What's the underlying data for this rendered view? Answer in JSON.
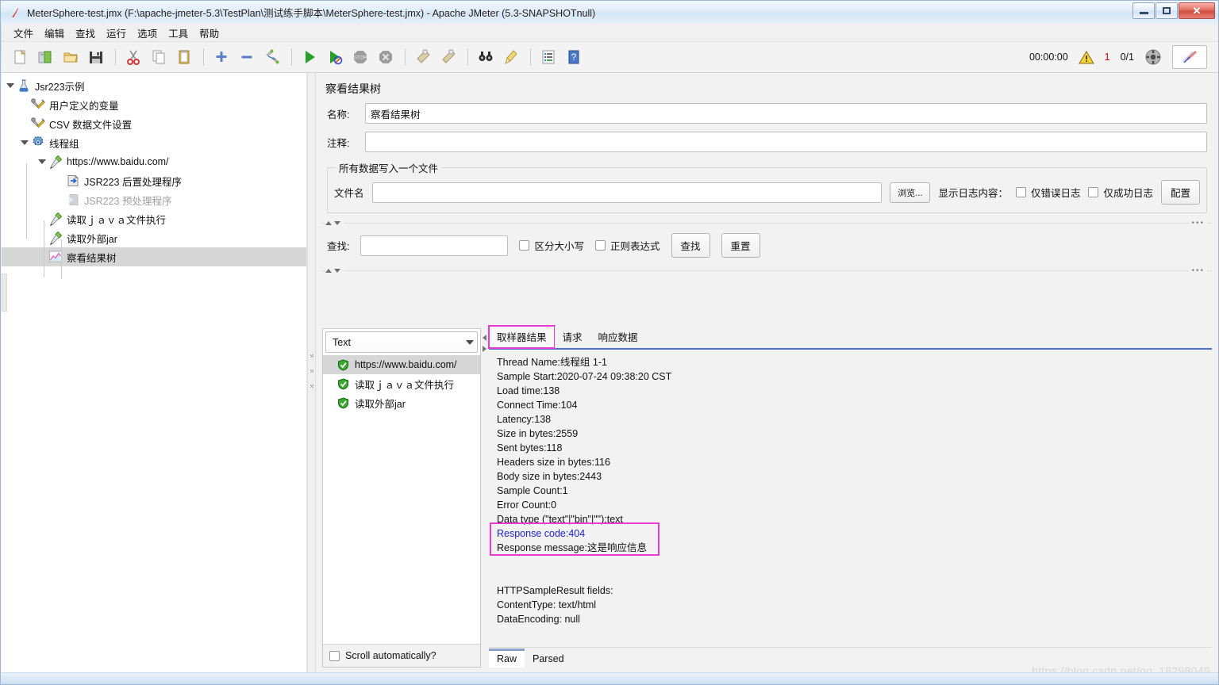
{
  "window": {
    "title": "MeterSphere-test.jmx (F:\\apache-jmeter-5.3\\TestPlan\\测试练手脚本\\MeterSphere-test.jmx) - Apache JMeter (5.3-SNAPSHOTnull)",
    "app_icon": "jmeter-feather-icon",
    "minimize_label": "",
    "maximize_label": "",
    "close_label": "✕"
  },
  "menubar": {
    "items": [
      {
        "label": "文件",
        "name": "menu-file"
      },
      {
        "label": "编辑",
        "name": "menu-edit"
      },
      {
        "label": "查找",
        "name": "menu-search"
      },
      {
        "label": "运行",
        "name": "menu-run"
      },
      {
        "label": "选项",
        "name": "menu-options"
      },
      {
        "label": "工具",
        "name": "menu-tools"
      },
      {
        "label": "帮助",
        "name": "menu-help"
      }
    ]
  },
  "toolbar": {
    "buttons": [
      {
        "icon": "new-file-icon",
        "name": "toolbar-new"
      },
      {
        "icon": "templates-icon",
        "name": "toolbar-templates"
      },
      {
        "icon": "open-folder-icon",
        "name": "toolbar-open"
      },
      {
        "icon": "save-floppy-icon",
        "name": "toolbar-save"
      },
      {
        "icon": "cut-scissors-icon",
        "name": "toolbar-cut"
      },
      {
        "icon": "copy-icon",
        "name": "toolbar-copy"
      },
      {
        "icon": "paste-clipboard-icon",
        "name": "toolbar-paste"
      },
      {
        "icon": "plus-icon",
        "name": "toolbar-expand-all"
      },
      {
        "icon": "minus-icon",
        "name": "toolbar-collapse-all"
      },
      {
        "icon": "toggle-icon",
        "name": "toolbar-toggle"
      },
      {
        "icon": "play-icon",
        "name": "toolbar-start"
      },
      {
        "icon": "play-no-timers-icon",
        "name": "toolbar-start-no-pauses"
      },
      {
        "icon": "stop-icon",
        "name": "toolbar-stop"
      },
      {
        "icon": "shutdown-icon",
        "name": "toolbar-shutdown"
      },
      {
        "icon": "clear-broom-icon",
        "name": "toolbar-clear"
      },
      {
        "icon": "clear-all-broom-icon",
        "name": "toolbar-clear-all"
      },
      {
        "icon": "binoculars-search-icon",
        "name": "toolbar-search"
      },
      {
        "icon": "reset-broom-icon",
        "name": "toolbar-reset-search"
      },
      {
        "icon": "function-helper-icon",
        "name": "toolbar-function-helper"
      },
      {
        "icon": "help-question-icon",
        "name": "toolbar-help"
      }
    ],
    "timer": "00:00:00",
    "warning_icon": "warning-triangle-icon",
    "warning_count": "1",
    "thread_count": "0/1",
    "remote_icon": "remote-engines-icon",
    "last_button_icon": "jmeter-feather-icon"
  },
  "tree": {
    "nodes": [
      {
        "label": "Jsr223示例",
        "icon": "test-plan-icon",
        "indent": 0,
        "twist": "open",
        "selected": false,
        "disabled": false,
        "name": "tree-node-test-plan"
      },
      {
        "label": "用户定义的变量",
        "icon": "config-tools-icon",
        "indent": 1,
        "twist": "none",
        "selected": false,
        "disabled": false,
        "name": "tree-node-user-defined-variables"
      },
      {
        "label": "CSV 数据文件设置",
        "icon": "config-tools-icon",
        "indent": 1,
        "twist": "none",
        "selected": false,
        "disabled": false,
        "name": "tree-node-csv-data-set"
      },
      {
        "label": "线程组",
        "icon": "thread-group-gear-icon",
        "indent": 1,
        "twist": "open",
        "selected": false,
        "disabled": false,
        "name": "tree-node-thread-group"
      },
      {
        "label": "https://www.baidu.com/",
        "icon": "http-sampler-pipette-icon",
        "indent": 2,
        "twist": "open",
        "selected": false,
        "disabled": false,
        "name": "tree-node-http-request-baidu"
      },
      {
        "label": "JSR223 后置处理程序",
        "icon": "post-processor-icon",
        "indent": 3,
        "twist": "none",
        "selected": false,
        "disabled": false,
        "name": "tree-node-jsr223-post-processor"
      },
      {
        "label": "JSR223 预处理程序",
        "icon": "pre-processor-icon",
        "indent": 3,
        "twist": "none",
        "selected": false,
        "disabled": true,
        "name": "tree-node-jsr223-pre-processor"
      },
      {
        "label": "读取ｊａｖａ文件执行",
        "icon": "http-sampler-pipette-icon",
        "indent": 2,
        "twist": "none",
        "selected": false,
        "disabled": false,
        "name": "tree-node-read-java-file"
      },
      {
        "label": "读取外部jar",
        "icon": "http-sampler-pipette-icon",
        "indent": 2,
        "twist": "none",
        "selected": false,
        "disabled": false,
        "name": "tree-node-read-external-jar"
      },
      {
        "label": "察看结果树",
        "icon": "view-results-tree-icon",
        "indent": 2,
        "twist": "none",
        "selected": true,
        "disabled": false,
        "name": "tree-node-view-results-tree"
      }
    ]
  },
  "right": {
    "panel_title": "察看结果树",
    "name_label": "名称:",
    "name_value": "察看结果树",
    "comment_label": "注释:",
    "comment_value": "",
    "fieldset_legend": "所有数据写入一个文件",
    "filename_label": "文件名",
    "filename_value": "",
    "browse_button": "浏览...",
    "log_display_label": "显示日志内容：",
    "errors_only_label": "仅错误日志",
    "errors_only_checked": false,
    "success_only_label": "仅成功日志",
    "success_only_checked": false,
    "configure_button": "配置",
    "search_label": "查找:",
    "search_value": "",
    "case_sensitive_label": "区分大小写",
    "case_sensitive_checked": false,
    "regex_label": "正则表达式",
    "regex_checked": false,
    "find_button": "查找",
    "reset_button": "重置"
  },
  "results": {
    "renderer_selected": "Text",
    "renderer_options": [
      "Text"
    ],
    "samples": [
      {
        "label": "https://www.baidu.com/",
        "status": "success",
        "selected": true,
        "name": "sample-result-baidu"
      },
      {
        "label": "读取ｊａｖａ文件执行",
        "status": "success",
        "selected": false,
        "name": "sample-result-read-java-file"
      },
      {
        "label": "读取外部jar",
        "status": "success",
        "selected": false,
        "name": "sample-result-read-external-jar"
      }
    ],
    "scroll_automatically_label": "Scroll automatically?",
    "scroll_automatically_checked": false,
    "tabs": [
      {
        "label": "取样器结果",
        "active": true,
        "highlighted": true,
        "name": "tab-sampler-result"
      },
      {
        "label": "请求",
        "active": false,
        "highlighted": false,
        "name": "tab-request"
      },
      {
        "label": "响应数据",
        "active": false,
        "highlighted": false,
        "name": "tab-response-data"
      }
    ],
    "detail_lines": [
      {
        "text": "Thread Name:线程组 1-1",
        "style": "normal"
      },
      {
        "text": "Sample Start:2020-07-24 09:38:20 CST",
        "style": "normal"
      },
      {
        "text": "Load time:138",
        "style": "normal"
      },
      {
        "text": "Connect Time:104",
        "style": "normal"
      },
      {
        "text": "Latency:138",
        "style": "normal"
      },
      {
        "text": "Size in bytes:2559",
        "style": "normal"
      },
      {
        "text": "Sent bytes:118",
        "style": "normal"
      },
      {
        "text": "Headers size in bytes:116",
        "style": "normal"
      },
      {
        "text": "Body size in bytes:2443",
        "style": "normal"
      },
      {
        "text": "Sample Count:1",
        "style": "normal"
      },
      {
        "text": "Error Count:0",
        "style": "normal"
      },
      {
        "text": "Data type (\"text\"|\"bin\"|\"\"):text",
        "style": "normal"
      },
      {
        "text": "Response code:404",
        "style": "blue"
      },
      {
        "text": "Response message:这是响应信息",
        "style": "normal"
      },
      {
        "text": "",
        "style": "normal"
      },
      {
        "text": "",
        "style": "normal"
      },
      {
        "text": "HTTPSampleResult fields:",
        "style": "normal"
      },
      {
        "text": "ContentType: text/html",
        "style": "normal"
      },
      {
        "text": "DataEncoding: null",
        "style": "normal"
      }
    ],
    "bottom_tabs": [
      {
        "label": "Raw",
        "active": true,
        "name": "bottom-tab-raw"
      },
      {
        "label": "Parsed",
        "active": false,
        "name": "bottom-tab-parsed"
      }
    ]
  },
  "watermark": "https://blog.csdn.net/qq_18298049",
  "colors": {
    "highlight_magenta": "#ea3bd5",
    "response_code_blue": "#2020cc",
    "tab_underline": "#4a6fd0",
    "selection_gray": "#d6d6d6",
    "warning_red": "#cc0000"
  }
}
